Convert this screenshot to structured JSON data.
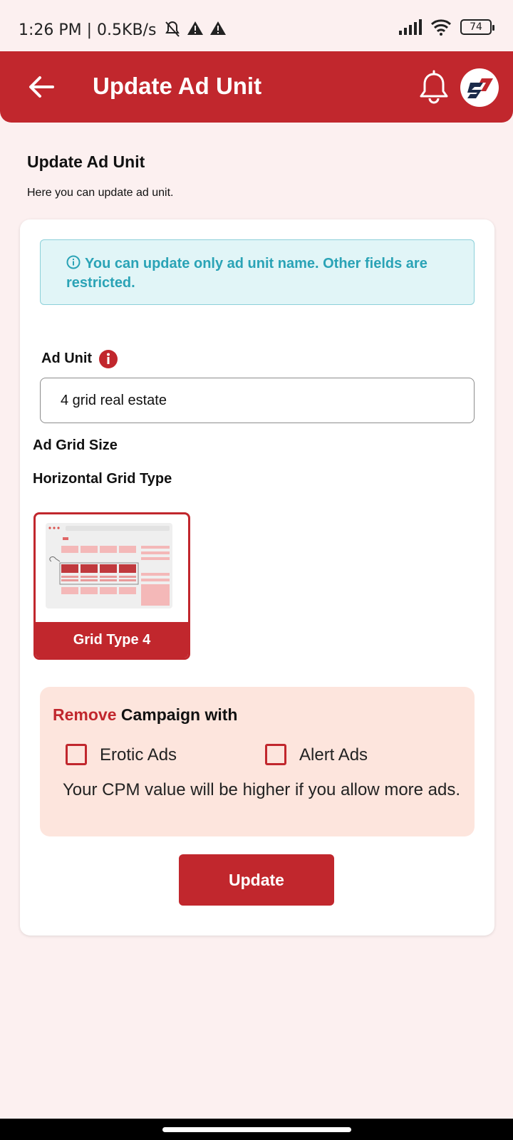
{
  "status_bar": {
    "time": "1:26 PM | 0.5KB/s",
    "battery": "74"
  },
  "app_bar": {
    "title": "Update Ad Unit"
  },
  "header": {
    "title": "Update Ad Unit",
    "subtitle": "Here you can update ad unit."
  },
  "notice": {
    "text": "You can update only ad unit name. Other fields are restricted."
  },
  "ad_unit": {
    "label": "Ad Unit",
    "value": "4 grid real estate"
  },
  "grid": {
    "size_label": "Ad Grid Size",
    "type_label": "Horizontal Grid Type",
    "selected_option": "Grid Type 4"
  },
  "remove_campaign": {
    "title_accent": "Remove",
    "title_rest": " Campaign with",
    "options": [
      "Erotic Ads",
      "Alert Ads"
    ],
    "note": "Your CPM value will be higher if you allow more ads."
  },
  "actions": {
    "update_label": "Update"
  },
  "colors": {
    "brand_red": "#c1272d",
    "info_teal": "#2aa3b6",
    "page_bg": "#fcf0f0"
  }
}
